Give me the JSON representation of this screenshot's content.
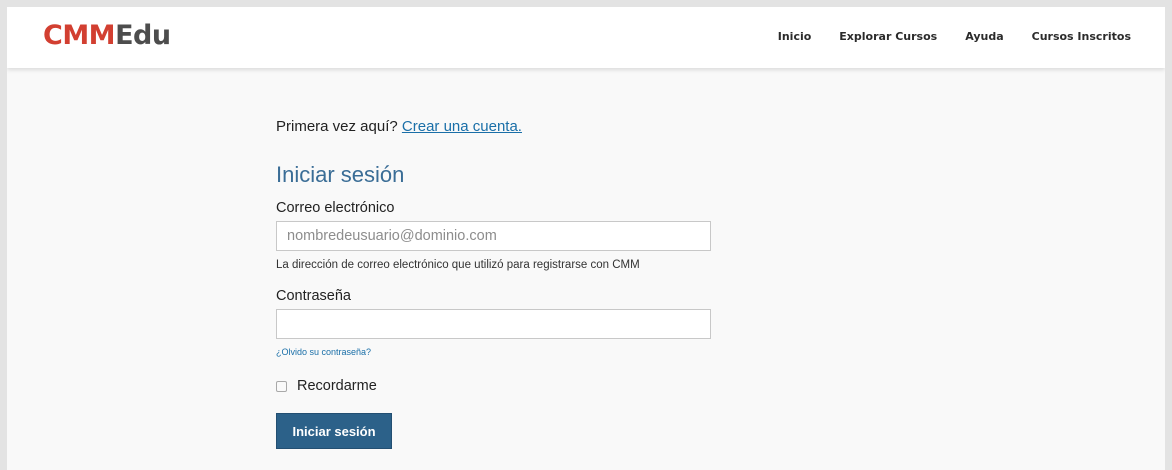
{
  "brand": {
    "part1": "CMM",
    "part2": "Edu",
    "color_primary": "#d23f31",
    "color_secondary": "#4d4d4d"
  },
  "nav": {
    "items": [
      "Inicio",
      "Explorar Cursos",
      "Ayuda",
      "Cursos Inscritos"
    ]
  },
  "signup": {
    "prompt": "Primera vez aquí?",
    "link": "Crear una cuenta."
  },
  "login": {
    "title": "Iniciar sesión",
    "email_label": "Correo electrónico",
    "email_placeholder": "nombredeusuario@dominio.com",
    "email_value": "",
    "email_hint": "La dirección de correo electrónico que utilizó para registrarse con CMM",
    "password_label": "Contraseña",
    "password_value": "",
    "forgot": "¿Olvido su contraseña?",
    "remember_label": "Recordarme",
    "remember_checked": false,
    "submit": "Iniciar sesión"
  },
  "colors": {
    "accent": "#2c6189",
    "link": "#1a6fa8",
    "title": "#3a6d96"
  }
}
